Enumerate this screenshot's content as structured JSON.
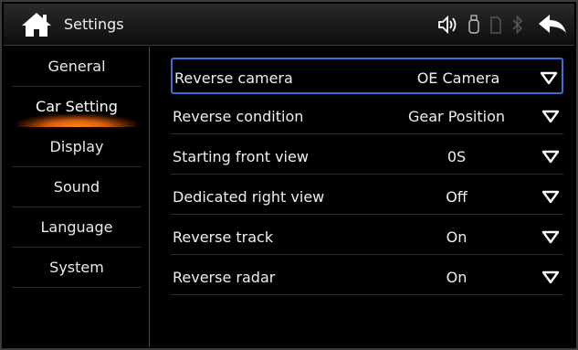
{
  "header": {
    "title": "Settings",
    "icons": [
      "home-icon",
      "volume-icon",
      "usb-icon",
      "sd-card-icon",
      "bluetooth-icon",
      "back-arrow-icon"
    ]
  },
  "sidebar": {
    "items": [
      {
        "label": "General",
        "active": false
      },
      {
        "label": "Car Setting",
        "active": true
      },
      {
        "label": "Display",
        "active": false
      },
      {
        "label": "Sound",
        "active": false
      },
      {
        "label": "Language",
        "active": false
      },
      {
        "label": "System",
        "active": false
      }
    ]
  },
  "settings": {
    "rows": [
      {
        "label": "Reverse camera",
        "value": "OE Camera",
        "selected": true
      },
      {
        "label": "Reverse condition",
        "value": "Gear Position",
        "selected": false
      },
      {
        "label": "Starting front view",
        "value": "0S",
        "selected": false
      },
      {
        "label": "Dedicated right view",
        "value": "Off",
        "selected": false
      },
      {
        "label": "Reverse track",
        "value": "On",
        "selected": false
      },
      {
        "label": "Reverse radar",
        "value": "On",
        "selected": false
      }
    ]
  },
  "colors": {
    "background": "#000000",
    "accent_orange": "#ff8a1a",
    "selection_border": "#3b6ed0",
    "text": "#f0f0f0"
  }
}
